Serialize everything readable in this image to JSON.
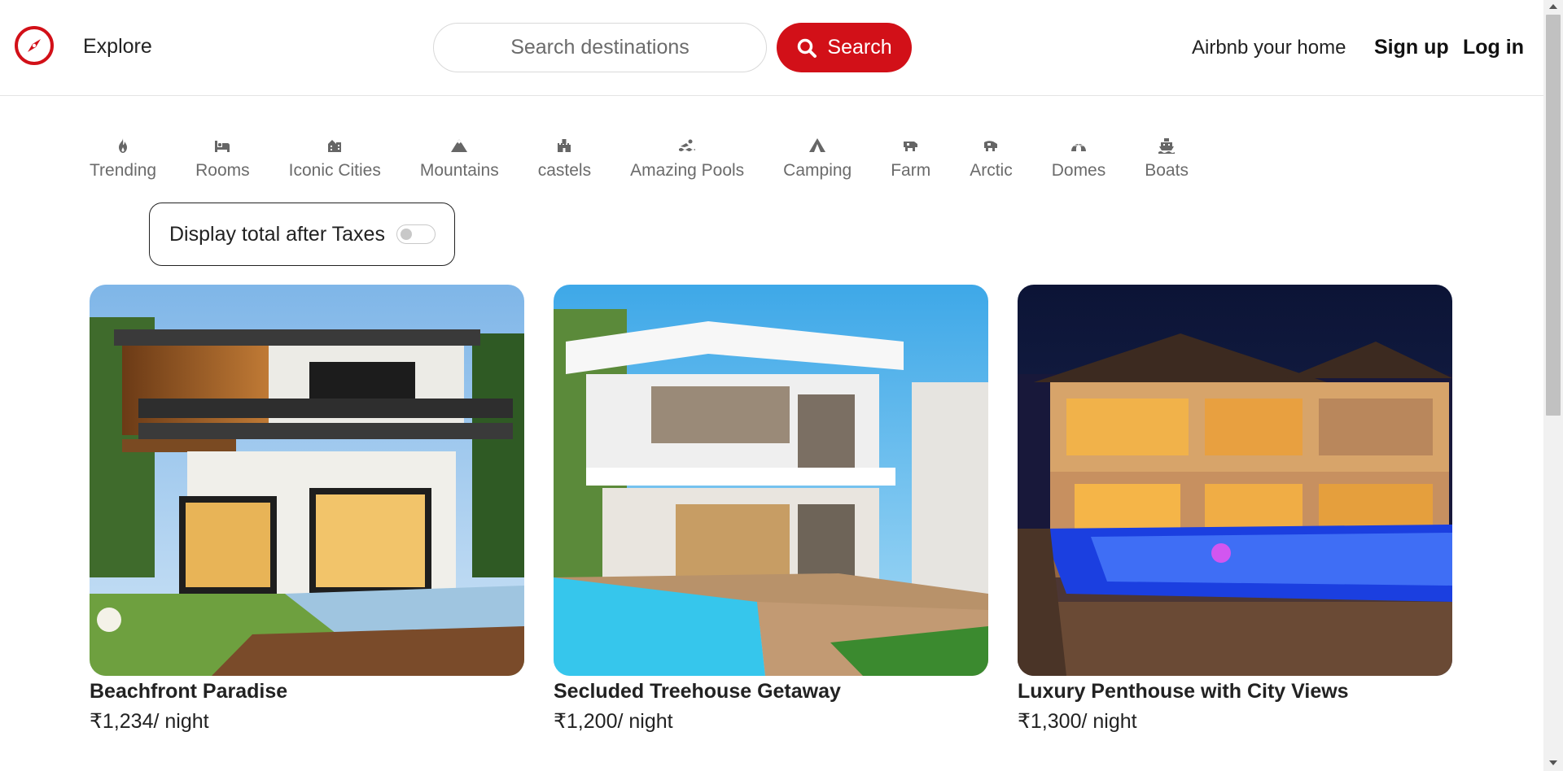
{
  "nav": {
    "explore": "Explore",
    "search_placeholder": "Search destinations",
    "search_button": "Search",
    "host_link": "Airbnb your home",
    "signup": "Sign up",
    "login": "Log in",
    "brand_color": "#d21018"
  },
  "filters": [
    {
      "label": "Trending",
      "icon": "fire-icon"
    },
    {
      "label": "Rooms",
      "icon": "bed-icon"
    },
    {
      "label": "Iconic Cities",
      "icon": "city-icon"
    },
    {
      "label": "Mountains",
      "icon": "mountain-icon"
    },
    {
      "label": "castels",
      "icon": "castle-icon"
    },
    {
      "label": "Amazing Pools",
      "icon": "swimmer-icon"
    },
    {
      "label": "Camping",
      "icon": "tent-icon"
    },
    {
      "label": "Farm",
      "icon": "cow-icon"
    },
    {
      "label": "Arctic",
      "icon": "snowmobile-icon"
    },
    {
      "label": "Domes",
      "icon": "igloo-icon"
    },
    {
      "label": "Boats",
      "icon": "ship-icon"
    }
  ],
  "tax_toggle": {
    "label": "Display total after Taxes",
    "enabled": false
  },
  "listings": [
    {
      "title": "Beachfront Paradise",
      "price": "₹1,234/ night",
      "image": "modern two-story house with pool at dusk"
    },
    {
      "title": "Secluded Treehouse Getaway",
      "price": "₹1,200/ night",
      "image": "white modern villa with pool under blue sky"
    },
    {
      "title": "Luxury Penthouse with City Views",
      "price": "₹1,300/ night",
      "image": "illuminated mansion with blue pool at night"
    }
  ]
}
